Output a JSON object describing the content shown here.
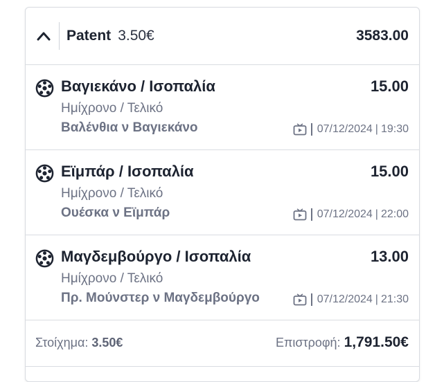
{
  "header": {
    "bet_type": "Patent",
    "stake_per_unit": "3.50€",
    "total_odds": "3583.00"
  },
  "selections": [
    {
      "market": "Βαγιεκάνο / Ισοπαλία",
      "odds": "15.00",
      "period": "Ημίχρονο / Τελικό",
      "event": "Βαλένθια ν Βαγιεκάνο",
      "date": "07/12/2024",
      "time": "19:30"
    },
    {
      "market": "Εϊμπάρ / Ισοπαλία",
      "odds": "15.00",
      "period": "Ημίχρονο / Τελικό",
      "event": "Ουέσκα ν Εϊμπάρ",
      "date": "07/12/2024",
      "time": "22:00"
    },
    {
      "market": "Μαγδεμβούργο / Ισοπαλία",
      "odds": "13.00",
      "period": "Ημίχρονο / Τελικό",
      "event": "Πρ. Μούνστερ ν Μαγδεμβούργο",
      "date": "07/12/2024",
      "time": "21:30"
    }
  ],
  "footer": {
    "stake_label": "Στοίχημα:",
    "stake_value": "3.50€",
    "return_label": "Επιστροφή:",
    "return_value": "1,791.50€"
  },
  "icons": {
    "collapse": "chevron-up-icon",
    "sport": "football-icon",
    "stream": "tv-play-icon"
  },
  "colors": {
    "text_primary": "#1d2330",
    "text_secondary": "#6c7284",
    "border": "#d9dce1"
  }
}
